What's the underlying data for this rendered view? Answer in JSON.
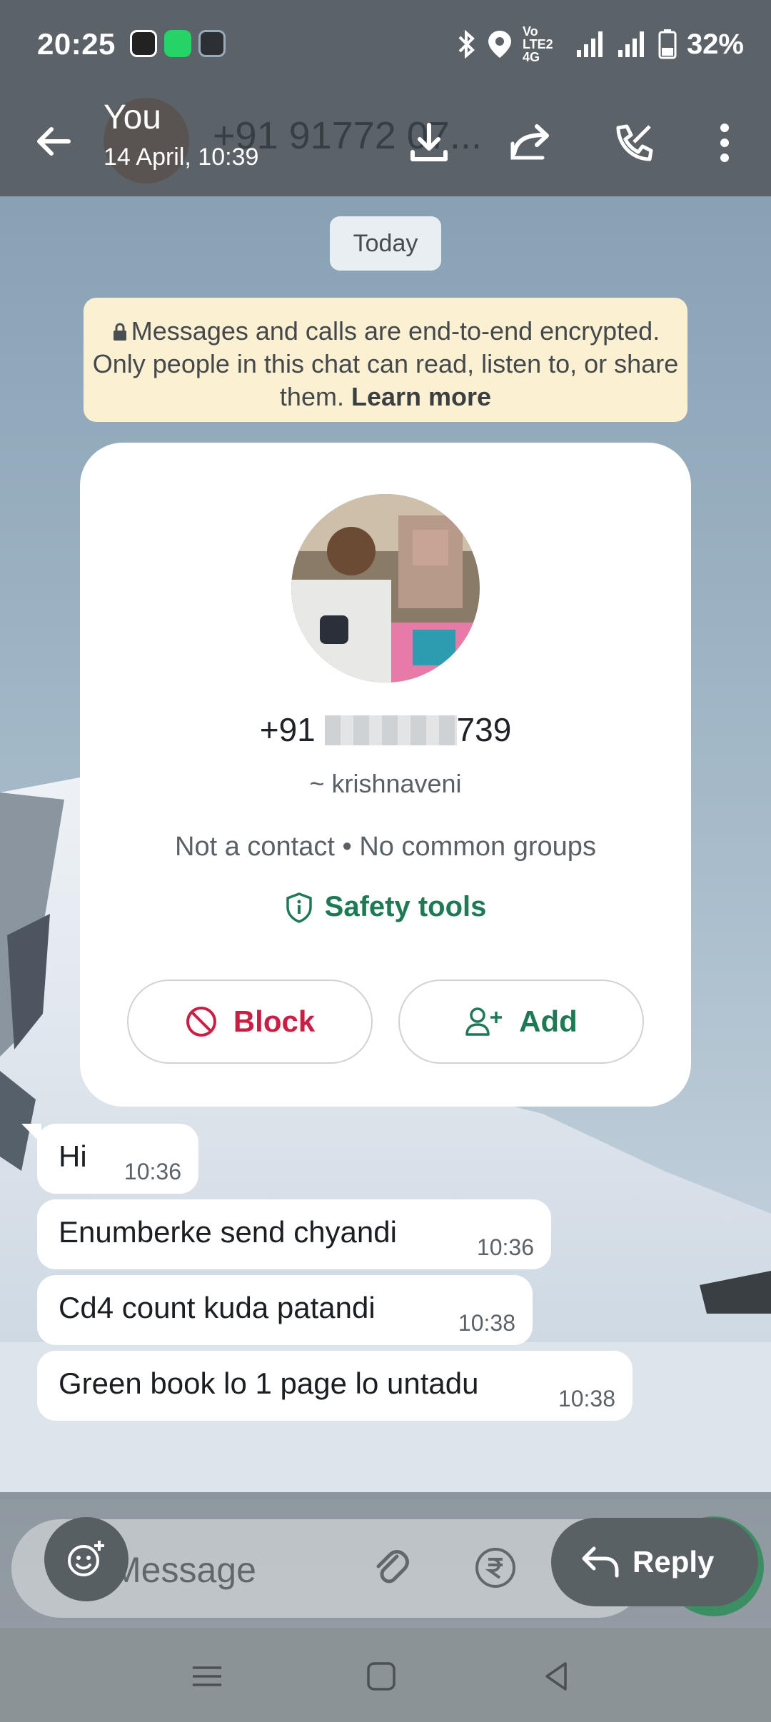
{
  "status_bar": {
    "time": "20:25",
    "battery": "32%",
    "network": "Vo LTE2 4G"
  },
  "app_bar": {
    "sender": "You",
    "timestamp": "14 April, 10:39",
    "underlying_title": "+91 91772 07..."
  },
  "chat": {
    "date_chip": "Today",
    "encryption_text": "Messages and calls are end-to-end encrypted. Only people in this chat can read, listen to, or share them.",
    "learn_more": "Learn more",
    "contact_card": {
      "phone_prefix": "+91",
      "phone_suffix": "739",
      "alias": "~ krishnaveni",
      "meta": "Not a contact • No common groups",
      "safety_tools": "Safety tools",
      "block_label": "Block",
      "add_label": "Add"
    },
    "messages": [
      {
        "text": "Hi",
        "time": "10:36"
      },
      {
        "text": "Enumberke send chyandi",
        "time": "10:36"
      },
      {
        "text": "Cd4 count kuda patandi",
        "time": "10:38"
      },
      {
        "text": "Green book lo 1 page lo untadu",
        "time": "10:38"
      }
    ]
  },
  "composer": {
    "placeholder": "Message",
    "reply_label": "Reply"
  },
  "colors": {
    "accent_green": "#1d7a55",
    "block_red": "#c91f45",
    "overlay_gray": "#5c6368"
  }
}
